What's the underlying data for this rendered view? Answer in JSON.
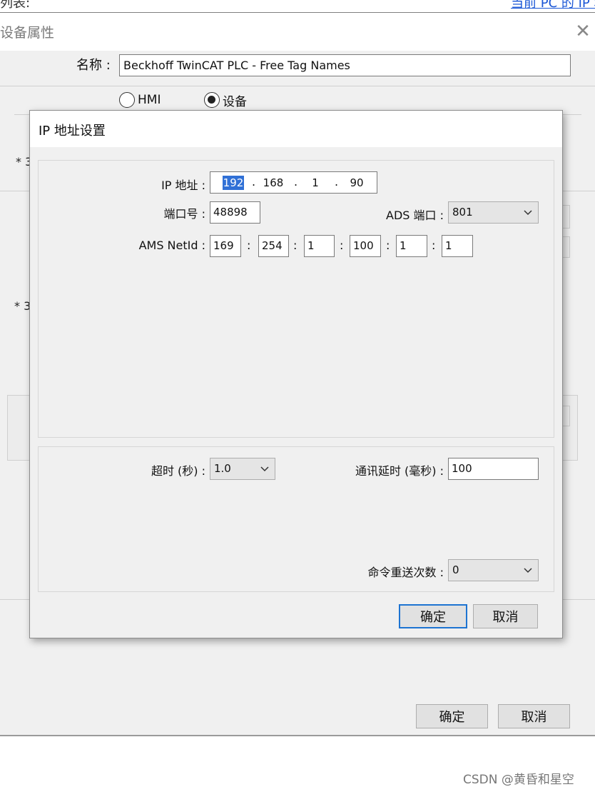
{
  "top_strip": {
    "left_text": "列表:",
    "link_text": "当前 PC 的 IP 地址"
  },
  "outer_dialog": {
    "title": "设备属性",
    "close_symbol": "✕",
    "name_label": "名称 :",
    "name_value": "Beckhoff TwinCAT PLC - Free Tag Names",
    "radio_hmi": "HMI",
    "radio_device": "设备",
    "peek_marker_1": "* 3",
    "peek_marker_2": "* 3",
    "ok_label": "确定",
    "cancel_label": "取消"
  },
  "ip_dialog": {
    "title": "IP 地址设置",
    "ip_label": "IP 地址 :",
    "ip": [
      "192",
      "168",
      "1",
      "90"
    ],
    "port_label": "端口号 :",
    "port_value": "48898",
    "ads_port_label": "ADS 端口 :",
    "ads_port_value": "801",
    "ams_label": "AMS NetId :",
    "ams": [
      "169",
      "254",
      "1",
      "100",
      "1",
      "1"
    ],
    "timeout_label": "超时 (秒) :",
    "timeout_value": "1.0",
    "delay_label": "通讯延时 (毫秒) :",
    "delay_value": "100",
    "retry_label": "命令重送次数 :",
    "retry_value": "0",
    "ok_label": "确定",
    "cancel_label": "取消"
  },
  "watermark": "CSDN @黄昏和星空",
  "colors": {
    "selection": "#3070d6",
    "focus_border": "#1e74d2",
    "link": "#1a56d6",
    "dialog_bg": "#f0f0f0"
  }
}
